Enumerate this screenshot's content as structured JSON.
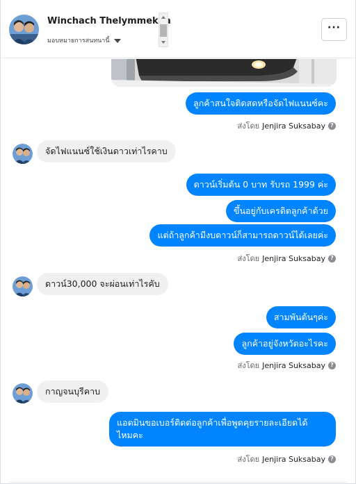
{
  "header": {
    "contact_name": "Winchach Thelymmekha",
    "assign_label": "มอบหมายการสนทนานี้",
    "more_label": "···"
  },
  "messages": {
    "m1": "ลูกค้าสนใจติดสดหรือจัดไฟแนนซ์คะ",
    "m2": "จัดไฟแนนซ์ใช้เงินดาวเท่าไรคาบ",
    "m3": "ดาวน์เริ่มต้น 0 บาท รับรถ 1999 ค่ะ",
    "m4": "ขึ้นอยู่กับเครดิตลูกค้าด้วย",
    "m5": "แต่ถ้าลูกค้ามีงบดาวน์ก็สามารถดาวน์ได้เลยค่ะ",
    "m6": "ดาวน์30,000  จะผ่อนเท่าไรคับ",
    "m7": "สามพันต้นๆค่ะ",
    "m8": "ลูกค้าอยู่จังหวัดอะไรคะ",
    "m9": "กาญจนบุรีคาบ",
    "m10_line1": "แอดมินขอเบอร์ติดต่อลูกค้าเพื่อพูดคุยรายละเอียดได้",
    "m10_line2": "ไหมคะ"
  },
  "sent_by": {
    "label": "ส่งโดย",
    "agent": "Jenjira Suksabay",
    "help_glyph": "?"
  }
}
